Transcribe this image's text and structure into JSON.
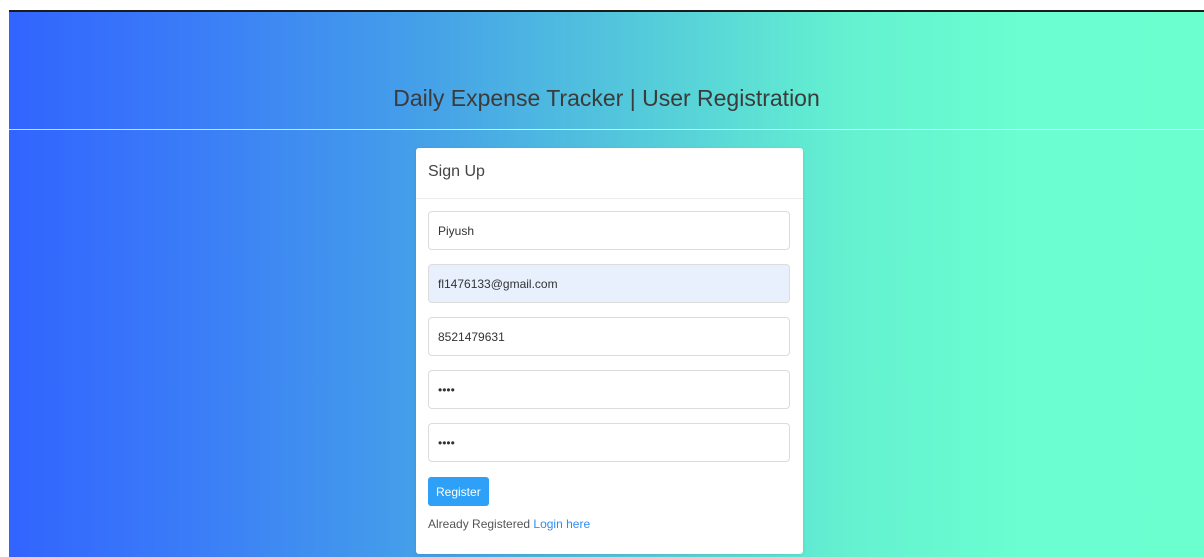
{
  "header": {
    "title": "Daily Expense Tracker | User Registration"
  },
  "card": {
    "title": "Sign Up",
    "fields": {
      "name": "Piyush",
      "email": "fl1476133@gmail.com",
      "phone": "8521479631",
      "password": "••••",
      "confirm_password": "••••"
    },
    "register_label": "Register",
    "already_registered_text": "Already Registered",
    "login_link_label": "Login here"
  },
  "colors": {
    "gradient_start": "#3264fe",
    "gradient_end": "#6bffd0",
    "button": "#2ea0f7",
    "link": "#2e8ef0",
    "autofill": "#e8f0fe"
  }
}
